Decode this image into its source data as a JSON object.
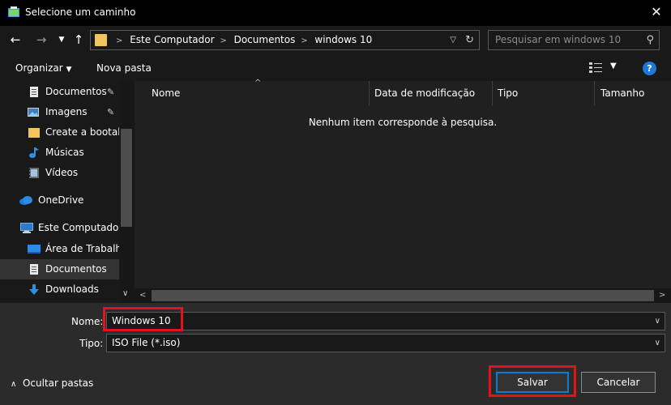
{
  "window": {
    "title": "Selecione um caminho"
  },
  "address": {
    "crumbs": [
      "Este Computador",
      "Documentos",
      "windows 10"
    ],
    "search_placeholder": "Pesquisar em windows 10"
  },
  "toolbar": {
    "organize": "Organizar",
    "new_folder": "Nova pasta"
  },
  "nav_pane": {
    "items": [
      {
        "label": "Documentos",
        "icon": "documents-icon",
        "pinned": true
      },
      {
        "label": "Imagens",
        "icon": "pictures-icon",
        "pinned": true
      },
      {
        "label": "Create a bootabl",
        "icon": "folder-icon",
        "pinned": false
      },
      {
        "label": "Músicas",
        "icon": "music-icon",
        "pinned": false
      },
      {
        "label": "Vídeos",
        "icon": "videos-icon",
        "pinned": false
      },
      {
        "label": "OneDrive",
        "icon": "onedrive-icon",
        "pinned": false
      },
      {
        "label": "Este Computador",
        "icon": "computer-icon",
        "pinned": false
      },
      {
        "label": "Área de Trabalho",
        "icon": "desktop-icon",
        "pinned": false
      },
      {
        "label": "Documentos",
        "icon": "documents-icon",
        "pinned": false,
        "selected": true
      },
      {
        "label": "Downloads",
        "icon": "downloads-icon",
        "pinned": false
      }
    ]
  },
  "columns": [
    "Nome",
    "Data de modificação",
    "Tipo",
    "Tamanho"
  ],
  "empty_message": "Nenhum item corresponde à pesquisa.",
  "form": {
    "name_label": "Nome:",
    "name_value": "Windows 10",
    "type_label": "Tipo:",
    "type_value": "ISO File (*.iso)"
  },
  "footer": {
    "hide_folders": "Ocultar pastas",
    "save": "Salvar",
    "cancel": "Cancelar"
  },
  "colors": {
    "highlight": "#e1141e",
    "accent": "#0b7cd6",
    "folder": "#f2c55c"
  }
}
